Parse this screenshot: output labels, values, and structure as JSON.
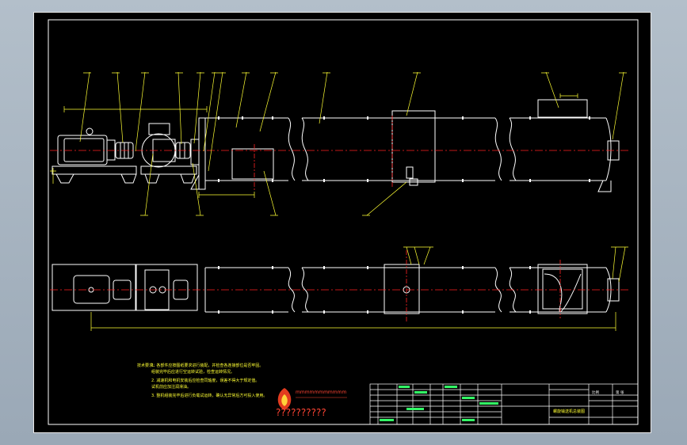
{
  "drawing": {
    "notes_heading": "技术要求：",
    "notes": [
      "1. 各部件应按图纸要求进行装配，并检查各连接部位是否牢固。",
      "   组装完毕后应进行空运转试验，检查运转情况。",
      "2. 减速机和电机安装后应检查同轴度，误差不得大于规定值。",
      "   试机前应加注润滑油。",
      "3. 整机组装完毕后进行负载试运转，确认无异常后方可投入使用。"
    ],
    "watermark_text": "??????????",
    "logo_caption": "mmmmmmmmmmm",
    "title_block": {
      "drawing_name": "螺旋输送机总装图",
      "scale_label": "比例",
      "sheet_label": "第 张"
    }
  },
  "colors": {
    "background": "#a8b4c1",
    "sheet": "#000000",
    "frame": "#ffffff",
    "equipment": "#ffffff",
    "centerline": "#ff2222",
    "leader": "#ffff33",
    "dimension": "#ffff33"
  }
}
